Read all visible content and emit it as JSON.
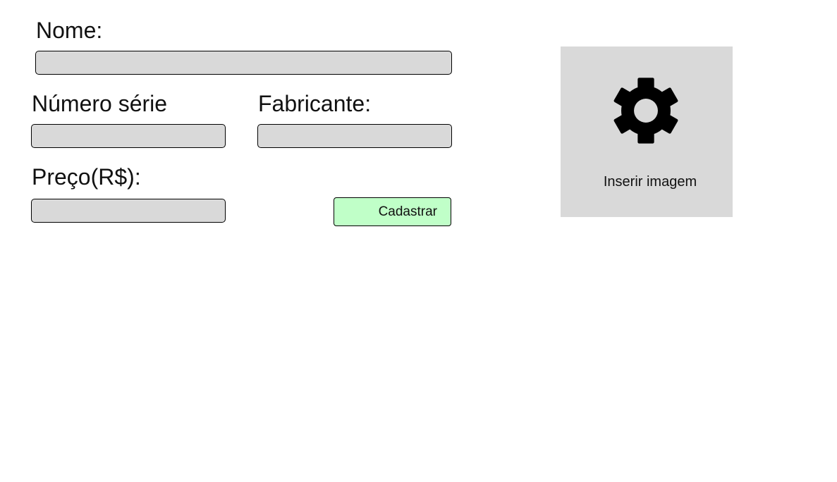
{
  "form": {
    "nome_label": "Nome:",
    "nome_value": "",
    "numero_serie_label": "Número série",
    "numero_serie_value": "",
    "fabricante_label": "Fabricante:",
    "fabricante_value": "",
    "preco_label": "Preço(R$):",
    "preco_value": "",
    "submit_label": "Cadastrar"
  },
  "image_upload": {
    "icon": "gear-icon",
    "label": "Inserir imagem"
  },
  "colors": {
    "field_background": "#d9d9d9",
    "submit_background": "#c0ffc8",
    "image_box_background": "#d9d9d9"
  }
}
